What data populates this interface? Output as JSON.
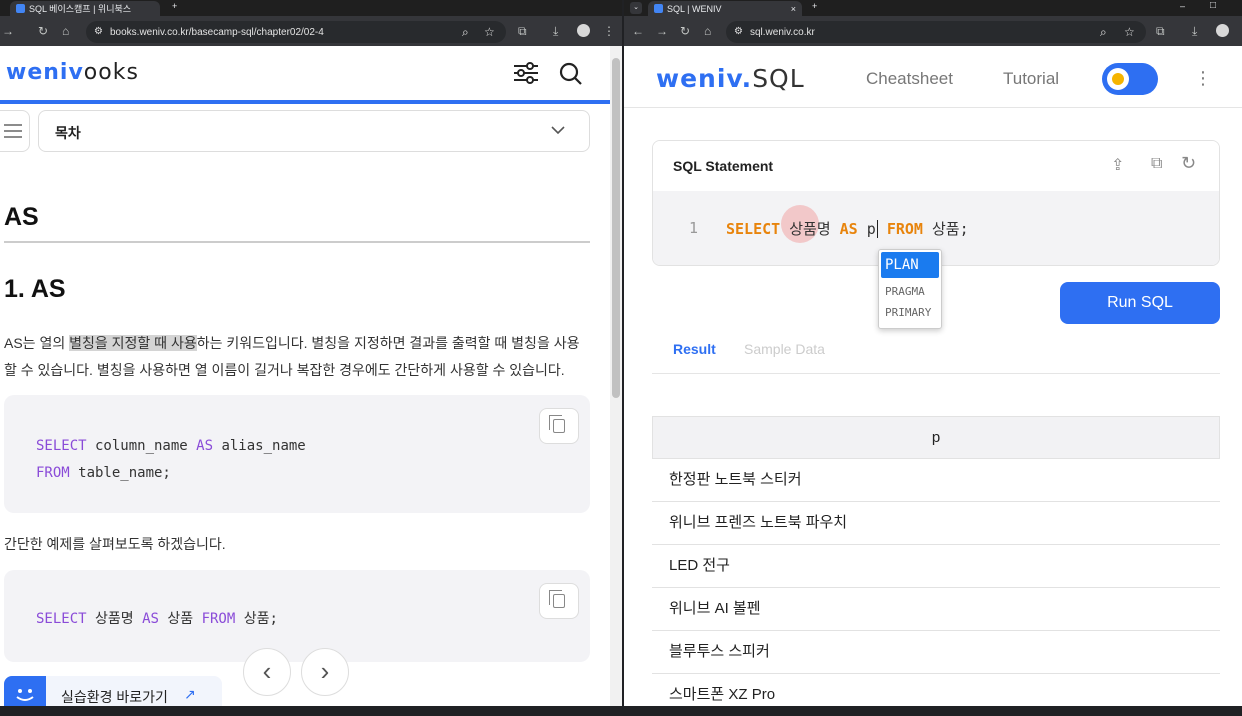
{
  "left_window": {
    "tab_title": "SQL 베이스캠프 | 위니북스",
    "url": "books.weniv.co.kr/basecamp-sql/chapter02/02-4",
    "logo_left": "weniv",
    "logo_right": "ooks",
    "toc_label": "목차",
    "h1": "AS",
    "h2": "1. AS",
    "para_highlight": "AS는 열의 ",
    "para_marked": "별칭을 지정할 때 사용",
    "para_rest": "하는 키워드입니다. 별칭을 지정하면 결과를 출력할 때 별칭을 사용",
    "para_line2": "할 수 있습니다. 별칭을 사용하면 열 이름이 길거나 복잡한 경우에도 간단하게 사용할 수 있습니다.",
    "code1": {
      "l1_kw1": "SELECT",
      "l1_t1": " column_name ",
      "l1_kw2": "AS",
      "l1_t2": " alias_name",
      "l2_kw": "FROM",
      "l2_t": " table_name;"
    },
    "example_text": "간단한 예제를 살펴보도록 하겠습니다.",
    "code2": {
      "kw1": "SELECT",
      "t1": " 상품명 ",
      "kw2": "AS",
      "t2": " 상품 ",
      "kw3": "FROM",
      "t3": " 상품;"
    },
    "practice_link": "실습환경 바로가기",
    "prev_arrow": "‹",
    "next_arrow": "›"
  },
  "right_window": {
    "tab_title": "SQL | WENIV",
    "url": "sql.weniv.co.kr",
    "logo_left": "weniv.",
    "logo_right": "SQL",
    "nav": [
      "Cheatsheet",
      "Tutorial"
    ],
    "panel_title": "SQL Statement",
    "editor": {
      "line_no": "1",
      "kw1": "SELECT",
      "t1": "상품명",
      "kw2": "AS",
      "t2": "p",
      "kw3": "FROM",
      "t3": "상품;"
    },
    "autocomplete": [
      "PLAN",
      "PRAGMA",
      "PRIMARY"
    ],
    "run_button": "Run SQL",
    "tabs": [
      "Result",
      "Sample Data"
    ],
    "result_header": "p",
    "result_rows": [
      "한정판 노트북 스티커",
      "위니브 프렌즈 노트북 파우치",
      "LED 전구",
      "위니브 AI 볼펜",
      "블루투스 스피커",
      "스마트폰 XZ Pro"
    ]
  },
  "colors": {
    "brand_blue": "#2e6ff2",
    "sql_keyword": "#e8840c",
    "code_keyword": "#8a4bd8"
  }
}
